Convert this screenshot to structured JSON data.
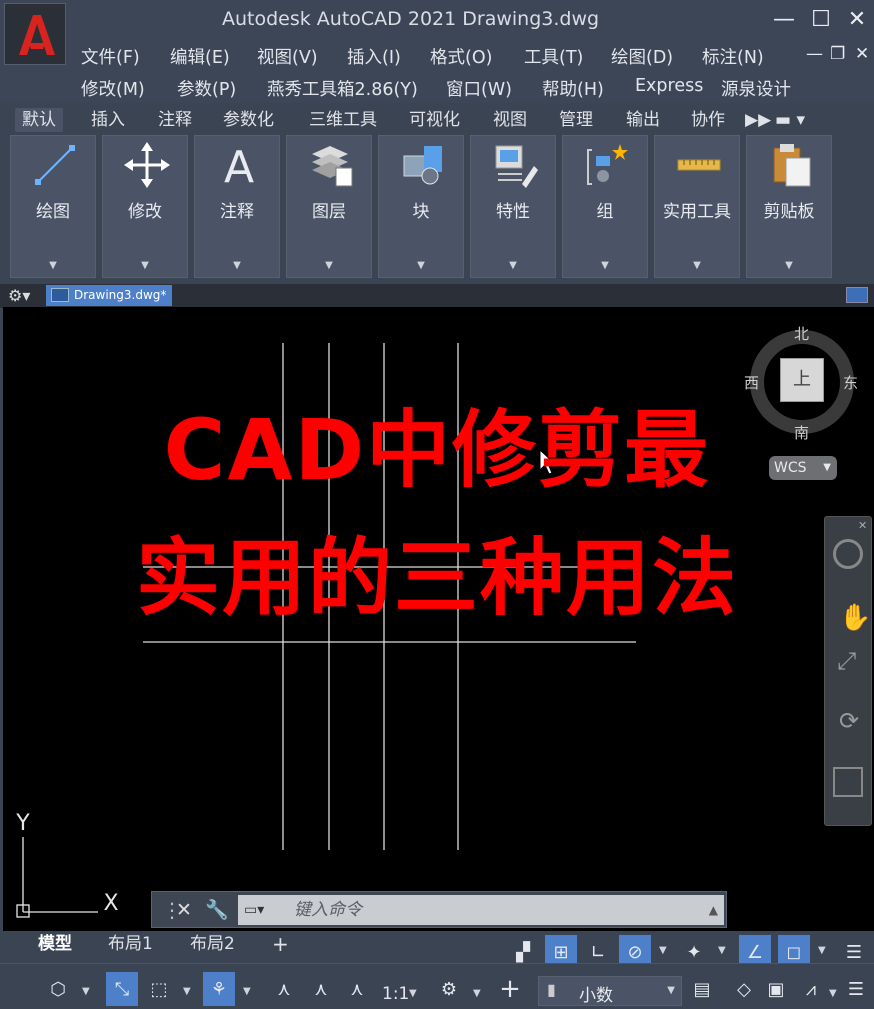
{
  "window": {
    "title": "Autodesk AutoCAD 2021    Drawing3.dwg",
    "minimize": "—",
    "maximize": "☐",
    "close": "✕"
  },
  "menu": {
    "row1": [
      "文件(F)",
      "编辑(E)",
      "视图(V)",
      "插入(I)",
      "格式(O)",
      "工具(T)",
      "绘图(D)",
      "标注(N)"
    ],
    "row2": [
      "修改(M)",
      "参数(P)",
      "燕秀工具箱2.86(Y)",
      "窗口(W)",
      "帮助(H)",
      "Express",
      "源泉设计"
    ]
  },
  "ribbon": {
    "tabs": [
      "默认",
      "插入",
      "注释",
      "参数化",
      "三维工具",
      "可视化",
      "视图",
      "管理",
      "输出",
      "协作"
    ],
    "panels": [
      "绘图",
      "修改",
      "注释",
      "图层",
      "块",
      "特性",
      "组",
      "实用工具",
      "剪贴板"
    ]
  },
  "file_tab": {
    "label": "Drawing3.dwg*"
  },
  "overlay": {
    "line1": "CAD中修剪最",
    "line2": "实用的三种用法",
    "color": "#ff0000"
  },
  "viewcube": {
    "north": "北",
    "south": "南",
    "east": "东",
    "west": "西",
    "face": "上",
    "wcs": "WCS"
  },
  "ucs": {
    "y": "Y",
    "x": "X"
  },
  "command": {
    "placeholder": "键入命令"
  },
  "layout_tabs": [
    "模型",
    "布局1",
    "布局2",
    "+"
  ],
  "status": {
    "scale": "1:1",
    "units": "小数"
  }
}
